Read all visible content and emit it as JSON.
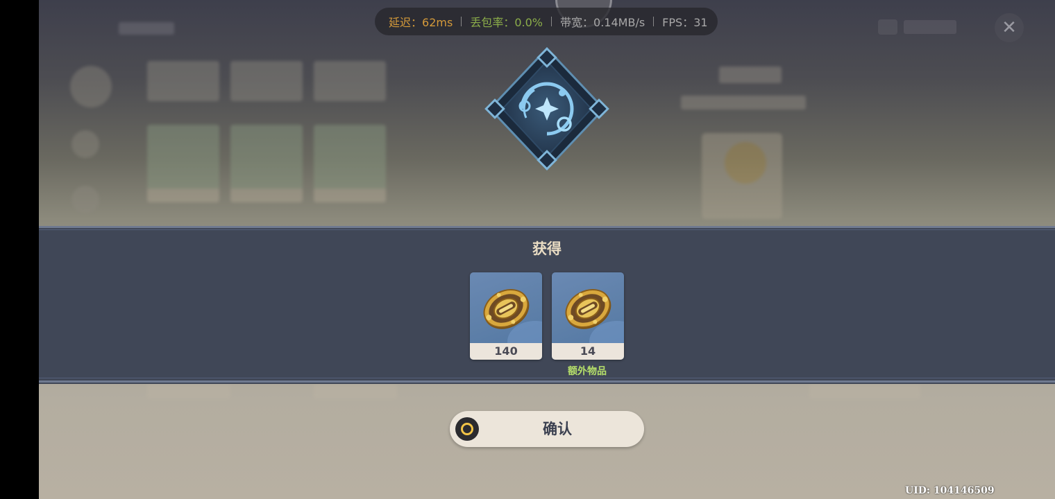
{
  "network": {
    "latency_label": "延迟",
    "latency_value": "62ms",
    "packet_loss_label": "丢包率",
    "packet_loss_value": "0.0%",
    "bandwidth_label": "带宽",
    "bandwidth_value": "0.14MB/s",
    "fps_label": "FPS",
    "fps_value": "31",
    "colors": {
      "latency": "#d49a3a",
      "packet_loss": "#8cae4a",
      "neutral": "#a8a8a8"
    }
  },
  "reward": {
    "title": "获得",
    "items": [
      {
        "icon": "gear-coin-material-icon",
        "count": "140",
        "tag": ""
      },
      {
        "icon": "gear-coin-material-icon",
        "count": "14",
        "tag": "额外物品"
      }
    ]
  },
  "confirm": {
    "label": "确认",
    "icon": "circle-button-icon"
  },
  "footer": {
    "uid": "UID: 104146509"
  },
  "theme": {
    "band_color": "#404757",
    "title_color": "#e9dcc3",
    "bonus_color": "#b6e06a",
    "accent_gold": "#f2c447"
  }
}
